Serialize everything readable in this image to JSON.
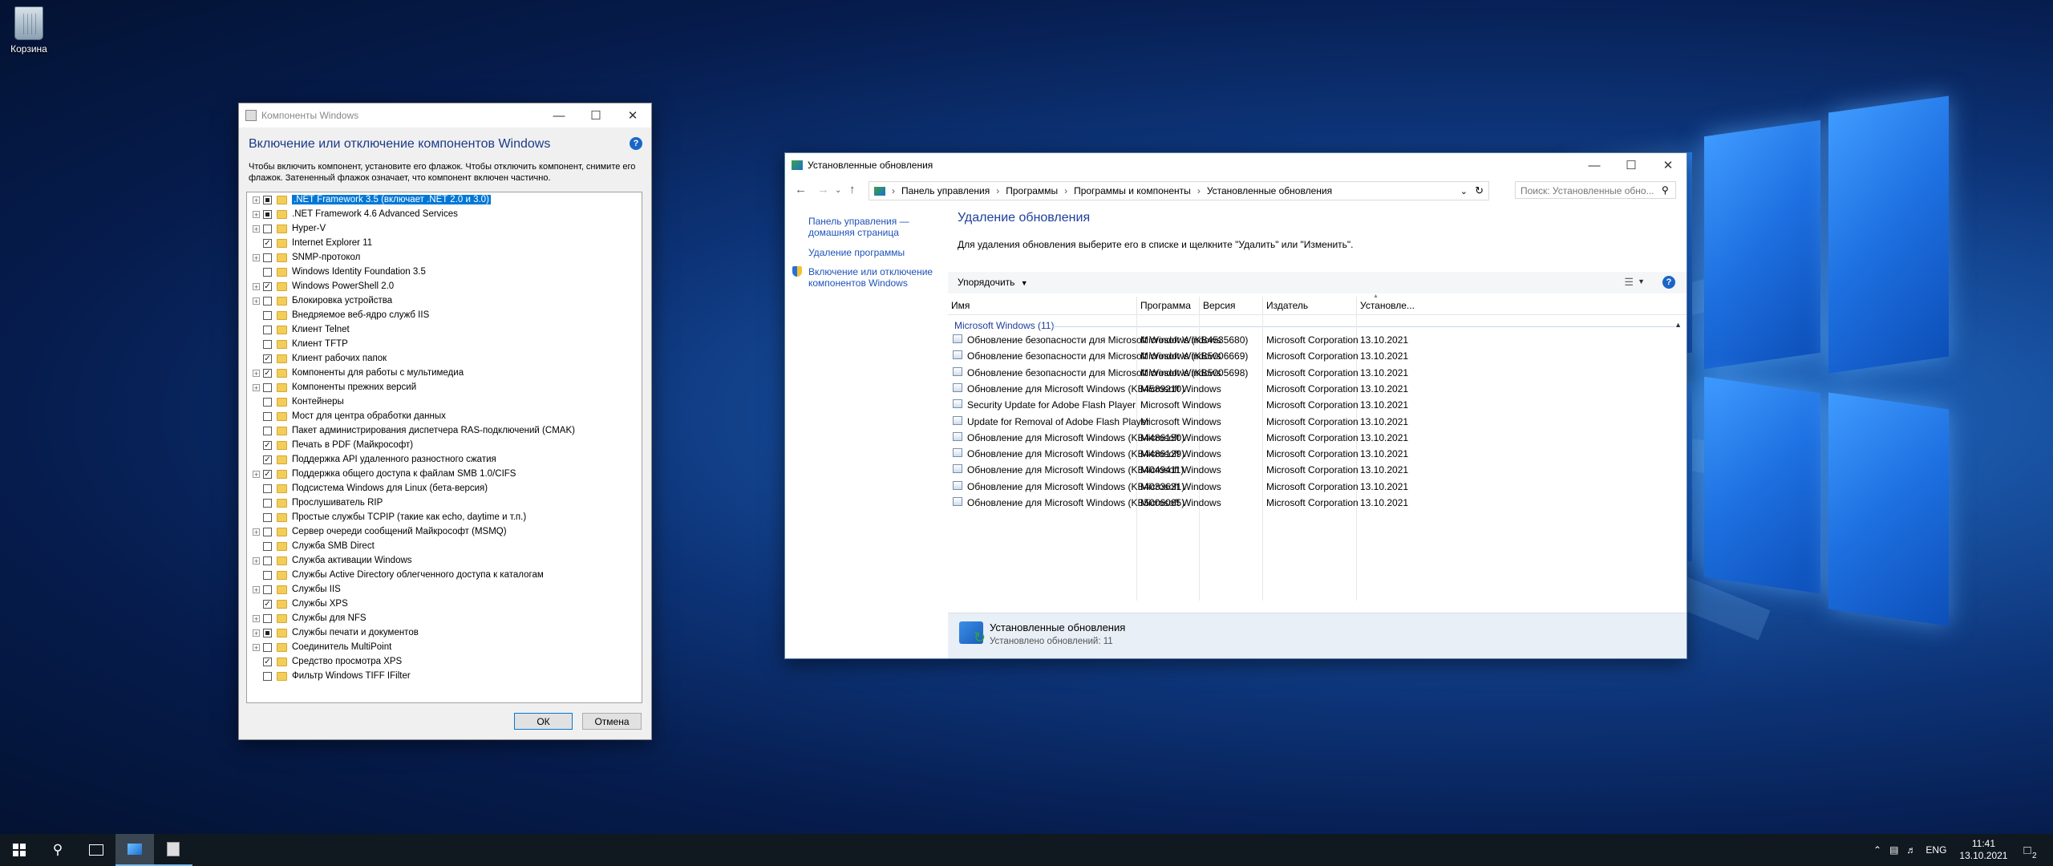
{
  "desktop": {
    "recycle_bin_label": "Корзина"
  },
  "features_window": {
    "title": "Компоненты Windows",
    "heading": "Включение или отключение компонентов Windows",
    "help": "?",
    "description": "Чтобы включить компонент, установите его флажок. Чтобы отключить компонент, снимите его флажок. Затененный флажок означает, что компонент включен частично.",
    "ok_label": "ОК",
    "cancel_label": "Отмена",
    "items": [
      {
        "label": ".NET Framework 3.5 (включает .NET 2.0 и 3.0)",
        "state": "partial",
        "expandable": true,
        "selected": true
      },
      {
        "label": ".NET Framework 4.6 Advanced Services",
        "state": "partial",
        "expandable": true,
        "selected": false
      },
      {
        "label": "Hyper-V",
        "state": "unchecked",
        "expandable": true,
        "selected": false
      },
      {
        "label": "Internet Explorer 11",
        "state": "checked",
        "expandable": false,
        "selected": false
      },
      {
        "label": "SNMP-протокол",
        "state": "unchecked",
        "expandable": true,
        "selected": false
      },
      {
        "label": "Windows Identity Foundation 3.5",
        "state": "unchecked",
        "expandable": false,
        "selected": false
      },
      {
        "label": "Windows PowerShell 2.0",
        "state": "checked",
        "expandable": true,
        "selected": false
      },
      {
        "label": "Блокировка устройства",
        "state": "unchecked",
        "expandable": true,
        "selected": false
      },
      {
        "label": "Внедряемое веб-ядро служб IIS",
        "state": "unchecked",
        "expandable": false,
        "selected": false
      },
      {
        "label": "Клиент Telnet",
        "state": "unchecked",
        "expandable": false,
        "selected": false
      },
      {
        "label": "Клиент TFTP",
        "state": "unchecked",
        "expandable": false,
        "selected": false
      },
      {
        "label": "Клиент рабочих папок",
        "state": "checked",
        "expandable": false,
        "selected": false
      },
      {
        "label": "Компоненты для работы с мультимедиа",
        "state": "checked",
        "expandable": true,
        "selected": false
      },
      {
        "label": "Компоненты прежних версий",
        "state": "unchecked",
        "expandable": true,
        "selected": false
      },
      {
        "label": "Контейнеры",
        "state": "unchecked",
        "expandable": false,
        "selected": false
      },
      {
        "label": "Мост для центра обработки данных",
        "state": "unchecked",
        "expandable": false,
        "selected": false
      },
      {
        "label": "Пакет администрирования диспетчера RAS-подключений (CMAK)",
        "state": "unchecked",
        "expandable": false,
        "selected": false
      },
      {
        "label": "Печать в PDF (Майкрософт)",
        "state": "checked",
        "expandable": false,
        "selected": false
      },
      {
        "label": "Поддержка API удаленного разностного сжатия",
        "state": "checked",
        "expandable": false,
        "selected": false
      },
      {
        "label": "Поддержка общего доступа к файлам SMB 1.0/CIFS",
        "state": "checked",
        "expandable": true,
        "selected": false
      },
      {
        "label": "Подсистема Windows для Linux (бета-версия)",
        "state": "unchecked",
        "expandable": false,
        "selected": false
      },
      {
        "label": "Прослушиватель RIP",
        "state": "unchecked",
        "expandable": false,
        "selected": false
      },
      {
        "label": "Простые службы TCPIP (такие как echo, daytime и т.п.)",
        "state": "unchecked",
        "expandable": false,
        "selected": false
      },
      {
        "label": "Сервер очереди сообщений Майкрософт (MSMQ)",
        "state": "unchecked",
        "expandable": true,
        "selected": false
      },
      {
        "label": "Служба SMB Direct",
        "state": "unchecked",
        "expandable": false,
        "selected": false
      },
      {
        "label": "Служба активации Windows",
        "state": "unchecked",
        "expandable": true,
        "selected": false
      },
      {
        "label": "Службы Active Directory облегченного доступа к каталогам",
        "state": "unchecked",
        "expandable": false,
        "selected": false
      },
      {
        "label": "Службы IIS",
        "state": "unchecked",
        "expandable": true,
        "selected": false
      },
      {
        "label": "Службы XPS",
        "state": "checked",
        "expandable": false,
        "selected": false
      },
      {
        "label": "Службы для NFS",
        "state": "unchecked",
        "expandable": true,
        "selected": false
      },
      {
        "label": "Службы печати и документов",
        "state": "partial",
        "expandable": true,
        "selected": false
      },
      {
        "label": "Соединитель MultiPoint",
        "state": "unchecked",
        "expandable": true,
        "selected": false
      },
      {
        "label": "Средство просмотра XPS",
        "state": "checked",
        "expandable": false,
        "selected": false
      },
      {
        "label": "Фильтр Windows TIFF IFilter",
        "state": "unchecked",
        "expandable": false,
        "selected": false
      }
    ]
  },
  "updates_window": {
    "title": "Установленные обновления",
    "breadcrumbs": [
      "Панель управления",
      "Программы",
      "Программы и компоненты",
      "Установленные обновления"
    ],
    "search_placeholder": "Поиск: Установленные обно...",
    "left_links": [
      "Панель управления — домашняя страница",
      "Удаление программы",
      "Включение или отключение компонентов Windows"
    ],
    "heading": "Удаление обновления",
    "subtitle": "Для удаления обновления выберите его в списке и щелкните \"Удалить\" или \"Изменить\".",
    "organize_label": "Упорядочить",
    "columns": [
      "Имя",
      "Программа",
      "Версия",
      "Издатель",
      "Установле..."
    ],
    "group_label": "Microsoft Windows (11)",
    "rows": [
      {
        "name": "Обновление безопасности для Microsoft Windows (KB4535680)",
        "program": "Microsoft Windows",
        "version": "",
        "publisher": "Microsoft Corporation",
        "installed": "13.10.2021"
      },
      {
        "name": "Обновление безопасности для Microsoft Windows (KB5006669)",
        "program": "Microsoft Windows",
        "version": "",
        "publisher": "Microsoft Corporation",
        "installed": "13.10.2021"
      },
      {
        "name": "Обновление безопасности для Microsoft Windows (KB5005698)",
        "program": "Microsoft Windows",
        "version": "",
        "publisher": "Microsoft Corporation",
        "installed": "13.10.2021"
      },
      {
        "name": "Обновление для Microsoft Windows (KB4589210)",
        "program": "Microsoft Windows",
        "version": "",
        "publisher": "Microsoft Corporation",
        "installed": "13.10.2021"
      },
      {
        "name": "Security Update for Adobe Flash Player",
        "program": "Microsoft Windows",
        "version": "",
        "publisher": "Microsoft Corporation",
        "installed": "13.10.2021"
      },
      {
        "name": "Update for Removal of Adobe Flash Player",
        "program": "Microsoft Windows",
        "version": "",
        "publisher": "Microsoft Corporation",
        "installed": "13.10.2021"
      },
      {
        "name": "Обновление для Microsoft Windows (KB4486150)",
        "program": "Microsoft Windows",
        "version": "",
        "publisher": "Microsoft Corporation",
        "installed": "13.10.2021"
      },
      {
        "name": "Обновление для Microsoft Windows (KB4486129)",
        "program": "Microsoft Windows",
        "version": "",
        "publisher": "Microsoft Corporation",
        "installed": "13.10.2021"
      },
      {
        "name": "Обновление для Microsoft Windows (KB4049411)",
        "program": "Microsoft Windows",
        "version": "",
        "publisher": "Microsoft Corporation",
        "installed": "13.10.2021"
      },
      {
        "name": "Обновление для Microsoft Windows (KB4033631)",
        "program": "Microsoft Windows",
        "version": "",
        "publisher": "Microsoft Corporation",
        "installed": "13.10.2021"
      },
      {
        "name": "Обновление для Microsoft Windows (KB5006065)",
        "program": "Microsoft Windows",
        "version": "",
        "publisher": "Microsoft Corporation",
        "installed": "13.10.2021"
      }
    ],
    "details_title": "Установленные обновления",
    "details_sub": "Установлено обновлений: 11"
  },
  "taskbar": {
    "language": "ENG",
    "time": "11:41",
    "date": "13.10.2021",
    "notification_count": "2"
  }
}
